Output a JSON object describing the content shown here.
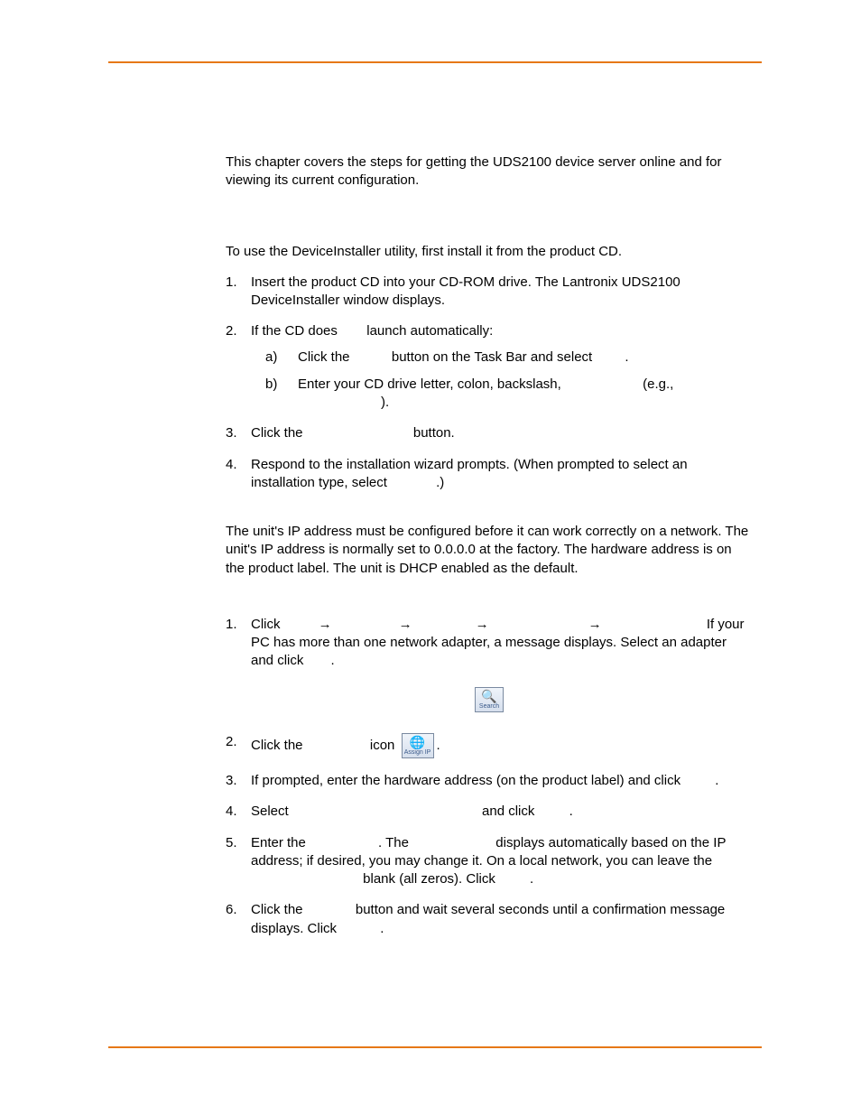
{
  "intro": "This chapter covers the steps for getting the UDS2100 device server online and for viewing its current configuration.",
  "install_intro": "To use the DeviceInstaller utility, first install it from the product CD.",
  "install_steps": {
    "s1": "Insert the product CD into your CD-ROM drive. The Lantronix UDS2100 DeviceInstaller window displays.",
    "s2_a": "If the CD does ",
    "s2_b": " launch automatically:",
    "s2a_a": "Click the ",
    "s2a_b": " button on the Task Bar and select ",
    "s2a_c": ".",
    "s2b_a": "Enter your CD drive letter, colon, backslash, ",
    "s2b_b": " (e.g., ",
    "s2b_c": ").",
    "s3_a": "Click the ",
    "s3_b": " button.",
    "s4_a": "Respond to the installation wizard prompts. (When prompted to select an installation type, select ",
    "s4_b": ".)"
  },
  "assign_intro": "The unit's IP address must be configured before it can work correctly on a network. The unit's IP address is normally set to 0.0.0.0 at the factory. The hardware address is on the product label. The unit is DHCP enabled as the default.",
  "assign_steps": {
    "s1_a": "Click ",
    "s1_b": " If your PC has more than one network adapter, a message displays. Select an adapter and click ",
    "s1_c": ".",
    "s2_a": "Click the ",
    "s2_b": " icon ",
    "s2_c": ".",
    "s3_a": "If prompted, enter the hardware address (on the product label) and click ",
    "s3_b": ".",
    "s4_a": "Select ",
    "s4_b": " and click ",
    "s4_c": ".",
    "s5_a": "Enter the ",
    "s5_b": ". The ",
    "s5_c": " displays automatically based on the IP address; if desired, you may change it. On a local network, you can leave the ",
    "s5_d": " blank (all zeros). Click ",
    "s5_e": ".",
    "s6_a": "Click the ",
    "s6_b": " button and wait several seconds until a confirmation message displays. Click ",
    "s6_c": "."
  },
  "icons": {
    "search_label": "Search",
    "assignip_label": "Assign IP"
  }
}
